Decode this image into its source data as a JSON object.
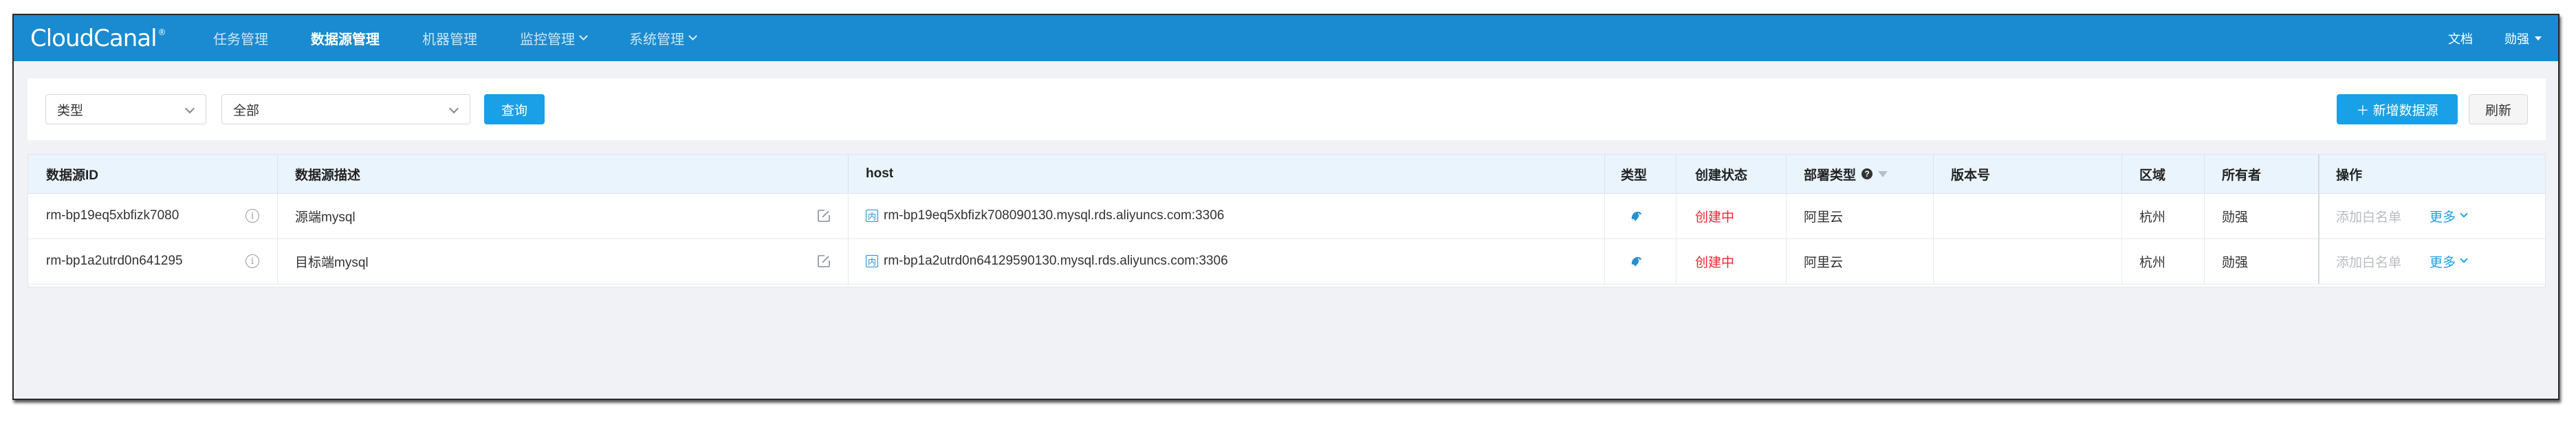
{
  "app": {
    "logo_text": "CloudCanal",
    "logo_reg": "®"
  },
  "nav": {
    "items": [
      {
        "label": "任务管理",
        "active": false,
        "has_dropdown": false
      },
      {
        "label": "数据源管理",
        "active": true,
        "has_dropdown": false
      },
      {
        "label": "机器管理",
        "active": false,
        "has_dropdown": false
      },
      {
        "label": "监控管理",
        "active": false,
        "has_dropdown": true
      },
      {
        "label": "系统管理",
        "active": false,
        "has_dropdown": true
      }
    ],
    "docs_label": "文档",
    "user_label": "勋强"
  },
  "filters": {
    "type_select": "类型",
    "scope_select": "全部",
    "query_label": "查询",
    "add_label": "＋ 新增数据源",
    "refresh_label": "刷新"
  },
  "table": {
    "headers": {
      "id": "数据源ID",
      "desc": "数据源描述",
      "host": "host",
      "type": "类型",
      "status": "创建状态",
      "deploy": "部署类型",
      "version": "版本号",
      "region": "区域",
      "owner": "所有者",
      "ops": "操作"
    },
    "rows": [
      {
        "id": "rm-bp19eq5xbfizk7080",
        "desc": "源端mysql",
        "host_tag": "内",
        "host": "rm-bp19eq5xbfizk708090130.mysql.rds.aliyuncs.com:3306",
        "status": "创建中",
        "deploy": "阿里云",
        "version": "",
        "region": "杭州",
        "owner": "勋强",
        "op_whitelist": "添加白名单",
        "op_more": "更多"
      },
      {
        "id": "rm-bp1a2utrd0n641295",
        "desc": "目标端mysql",
        "host_tag": "内",
        "host": "rm-bp1a2utrd0n64129590130.mysql.rds.aliyuncs.com:3306",
        "status": "创建中",
        "deploy": "阿里云",
        "version": "",
        "region": "杭州",
        "owner": "勋强",
        "op_whitelist": "添加白名单",
        "op_more": "更多"
      }
    ]
  },
  "colors": {
    "topbar": "#1a8bd0",
    "primary": "#1aa0e6",
    "status_creating": "#f0262d",
    "mysql_icon": "#2a8fd0"
  }
}
